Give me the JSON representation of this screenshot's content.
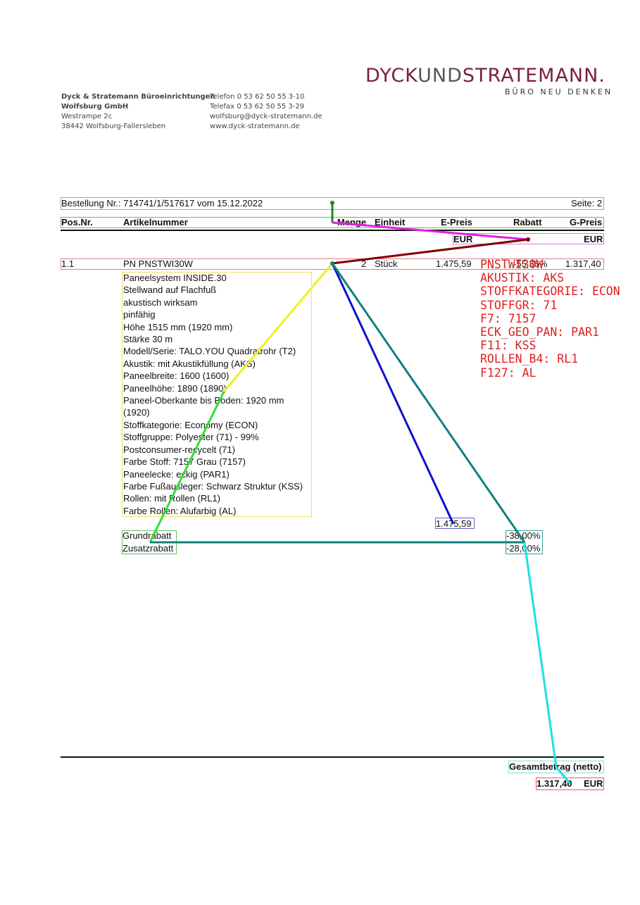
{
  "company": {
    "logo_main": "DYCK",
    "logo_und": "UND",
    "logo_rest": "STRATEMANN.",
    "tagline": "BÜRO NEU DENKEN",
    "sender_lines": [
      "Dyck & Stratemann Büroeinrichtungen",
      "Wolfsburg GmbH",
      "Westrampe 2c",
      "38442 Wolfsburg-Fallersleben"
    ],
    "contact_lines": [
      "Telefon  0 53 62  50 55 3-10",
      "Telefax  0 53 62  50 55 3-29",
      "wolfsburg@dyck-stratemann.de",
      "www.dyck-stratemann.de"
    ]
  },
  "order": {
    "title": "Bestellung Nr.: 714741/1/517617 vom 15.12.2022",
    "page": "Seite: 2"
  },
  "table": {
    "headers": {
      "pos": "Pos.Nr.",
      "article": "Artikelnummer",
      "qty": "Menge",
      "unit": "Einheit",
      "eprice": "E-Preis",
      "discount": "Rabatt",
      "gprice": "G-Preis"
    },
    "currency_eprice": "EUR",
    "currency_gprice": "EUR"
  },
  "item": {
    "pos": "1.1",
    "article": "PN PNSTWI30W",
    "qty": "2",
    "unit": "Stück",
    "eprice": "1.475,59",
    "discount": "-55,36%",
    "gprice": "1.317,40",
    "description": [
      "Paneelsystem INSIDE.30",
      "Stellwand auf Flachfuß",
      "akustisch wirksam",
      "pinfähig",
      "Höhe 1515 mm (1920 mm)",
      "Stärke 30 m",
      "Modell/Serie: TALO.YOU Quadratrohr (T2)",
      "Akustik: mit Akustikfüllung (AKS)",
      "Paneelbreite: 1600 (1600)",
      "Paneelhöhe: 1890 (1890)",
      "Paneel-Oberkante bis Boden: 1920 mm",
      "(1920)",
      "Stoffkategorie: Economy (ECON)",
      "Stoffgruppe: Polyester (71) - 99%",
      "Postconsumer-recycelt (71)",
      "Farbe Stoff: 7157 Grau (7157)",
      "Paneelecke: eckig (PAR1)",
      "Farbe Fußausleger: Schwarz Struktur (KSS)",
      "Rollen: mit Rollen (RL1)",
      "Farbe Rollen: Alufarbig (AL)"
    ],
    "base_price": "1.475,59",
    "discounts": [
      {
        "label": "Grundrabatt",
        "value": "-38,00%"
      },
      {
        "label": "Zusatzrabatt",
        "value": "-28,00%"
      }
    ]
  },
  "codes": [
    "PNSTWI30W",
    "AKUSTIK: AKS",
    "STOFFKATEGORIE: ECON",
    "STOFFGR: 71",
    "F7: 7157",
    "ECK_GEO_PAN: PAR1",
    "F11: KSS",
    "ROLLEN_B4: RL1",
    "F127: AL"
  ],
  "totals": {
    "label": "Gesamtbetrag (netto)",
    "amount": "1.317,40",
    "currency": "EUR"
  },
  "annotation_colors": {
    "order": "#9a9ad8",
    "row": "#e08080",
    "description": "#f0e060",
    "discounts": "#60c060",
    "eprice": "#6060d0",
    "discount_vals": "#30a0a0",
    "total_label": "#80e0e0",
    "total_amount": "#e06060"
  }
}
